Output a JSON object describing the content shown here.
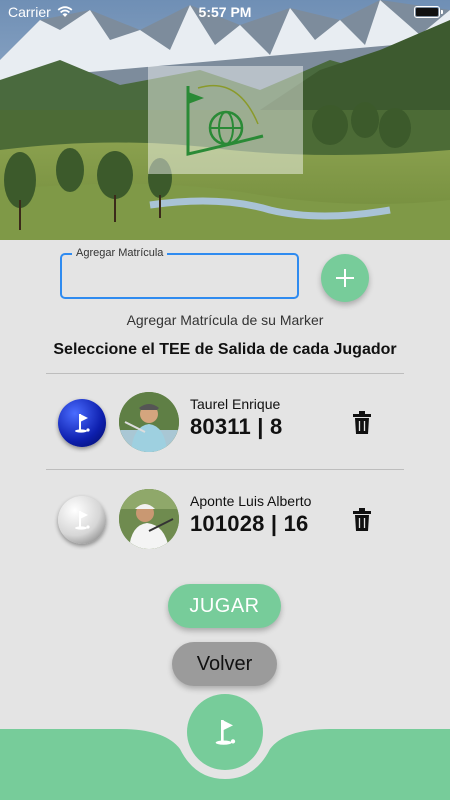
{
  "status_bar": {
    "carrier": "Carrier",
    "time": "5:57 PM"
  },
  "header": {
    "logo_alt": "Club logo"
  },
  "matricula": {
    "label": "Agregar Matrícula",
    "value": "",
    "placeholder": "",
    "add_icon": "plus-icon"
  },
  "helper_text": "Agregar Matrícula de su Marker",
  "section_title": "Seleccione el TEE de Salida de cada Jugador",
  "players": [
    {
      "name": "Taurel Enrique",
      "numbers": "80311 | 8",
      "tee_color": "blue"
    },
    {
      "name": "Aponte Luis Alberto",
      "numbers": "101028 | 16",
      "tee_color": "white"
    }
  ],
  "actions": {
    "play": "JUGAR",
    "back": "Volver"
  },
  "colors": {
    "accent_green": "#77cc9a",
    "input_border": "#2f8bf0",
    "background": "#e4e4e4"
  }
}
